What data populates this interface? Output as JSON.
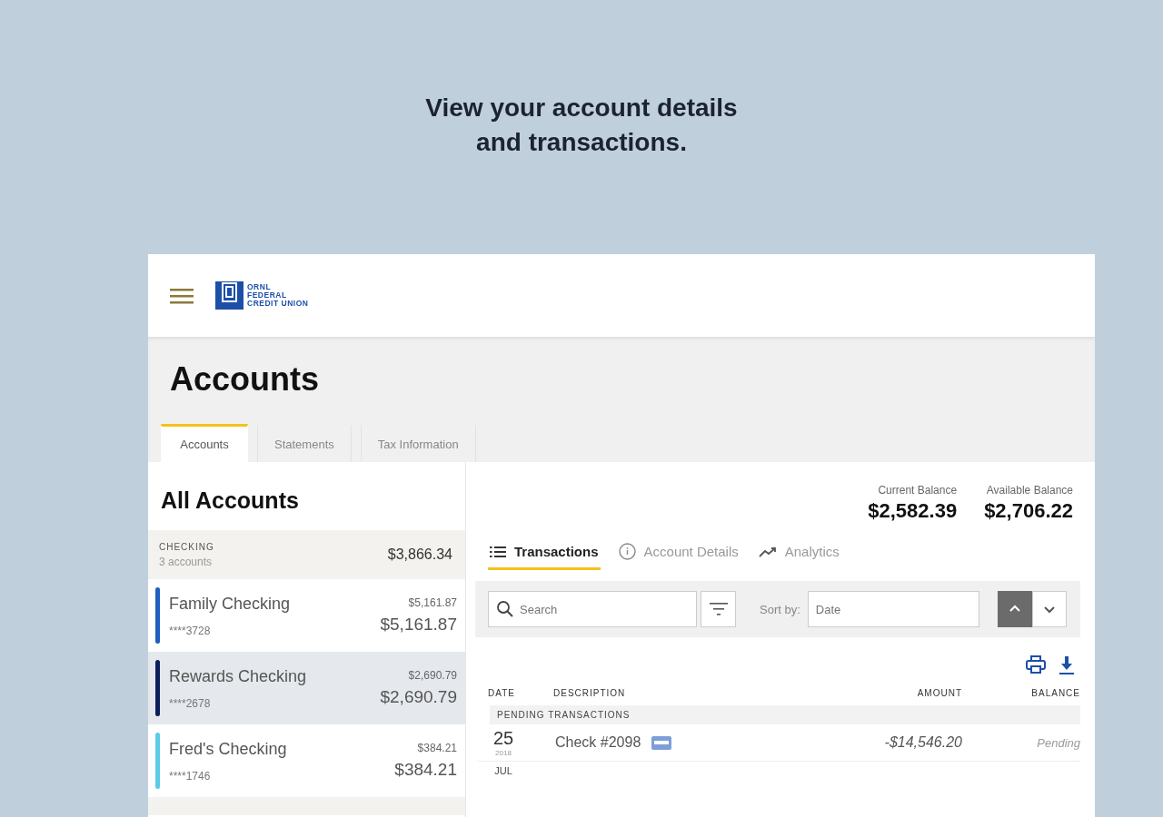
{
  "headline": [
    "View your account details",
    "and transactions."
  ],
  "header": {
    "logo_lines": [
      "ORNL",
      "FEDERAL",
      "CREDIT UNION"
    ]
  },
  "page_title": "Accounts",
  "page_tabs": [
    {
      "label": "Accounts",
      "selected": true
    },
    {
      "label": "Statements",
      "selected": false
    },
    {
      "label": "Tax Information",
      "selected": false
    }
  ],
  "sidebar": {
    "title": "All Accounts",
    "group": {
      "name": "CHECKING",
      "count": "3 accounts",
      "total": "$3,866.34"
    },
    "accounts": [
      {
        "name": "Family Checking",
        "number": "****3728",
        "balance_small": "$5,161.87",
        "balance": "$5,161.87",
        "color": "#1f5fbf",
        "selected": false
      },
      {
        "name": "Rewards Checking",
        "number": "****2678",
        "balance_small": "$2,690.79",
        "balance": "$2,690.79",
        "color": "#0c1f5c",
        "selected": true
      },
      {
        "name": "Fred's Checking",
        "number": "****1746",
        "balance_small": "$384.21",
        "balance": "$384.21",
        "color": "#5ccbea",
        "selected": false
      }
    ]
  },
  "balances": [
    {
      "label": "Current Balance",
      "value": "$2,582.39"
    },
    {
      "label": "Available Balance",
      "value": "$2,706.22"
    }
  ],
  "detail_tabs": [
    {
      "label": "Transactions",
      "kind": "list",
      "selected": true
    },
    {
      "label": "Account Details",
      "kind": "info",
      "selected": false
    },
    {
      "label": "Analytics",
      "kind": "trend",
      "selected": false
    }
  ],
  "toolbar": {
    "search_placeholder": "Search",
    "sort_label": "Sort by:",
    "sort_placeholder": "Date",
    "sort_ascending": true
  },
  "table": {
    "columns": [
      "DATE",
      "DESCRIPTION",
      "AMOUNT",
      "BALANCE"
    ],
    "section": "PENDING TRANSACTIONS",
    "rows": [
      {
        "day": "25",
        "year": "2018",
        "description": "Check #2098",
        "amount": "-$14,546.20",
        "balance": "Pending",
        "check_icon": true
      },
      {
        "month": "JUL"
      }
    ]
  }
}
